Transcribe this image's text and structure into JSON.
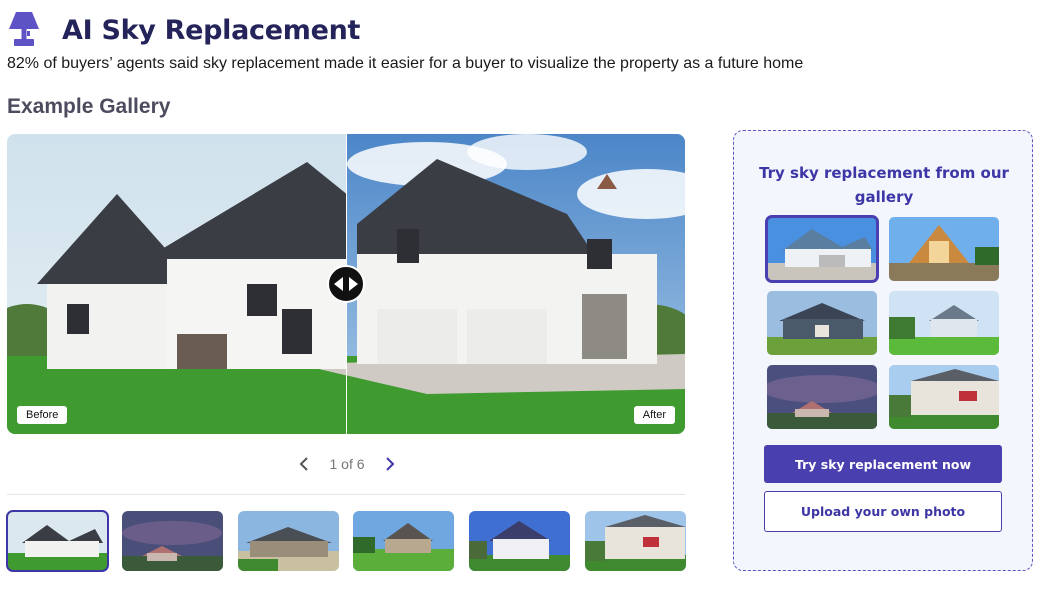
{
  "page": {
    "title": "AI Sky Replacement",
    "subtitle": "82% of buyers’ agents said sky replacement made it easier for a buyer to visualize the property as a future home",
    "section_title": "Example Gallery"
  },
  "comparison": {
    "before_label": "Before",
    "after_label": "After"
  },
  "pager": {
    "count_text": "1 of 6",
    "current": 1,
    "total": 6
  },
  "gallery_panel": {
    "title": "Try sky replacement from our gallery",
    "primary_button": "Try sky replacement now",
    "secondary_button": "Upload your own photo"
  },
  "icons": {
    "logo": "lamp-icon",
    "prev": "chevron-left-icon",
    "next": "chevron-right-icon",
    "handle": "left-right-arrows-icon"
  },
  "colors": {
    "accent": "#4a3fae",
    "title": "#25245a",
    "panel_bg": "#f4f6fd",
    "logo": "#5d53c4"
  }
}
